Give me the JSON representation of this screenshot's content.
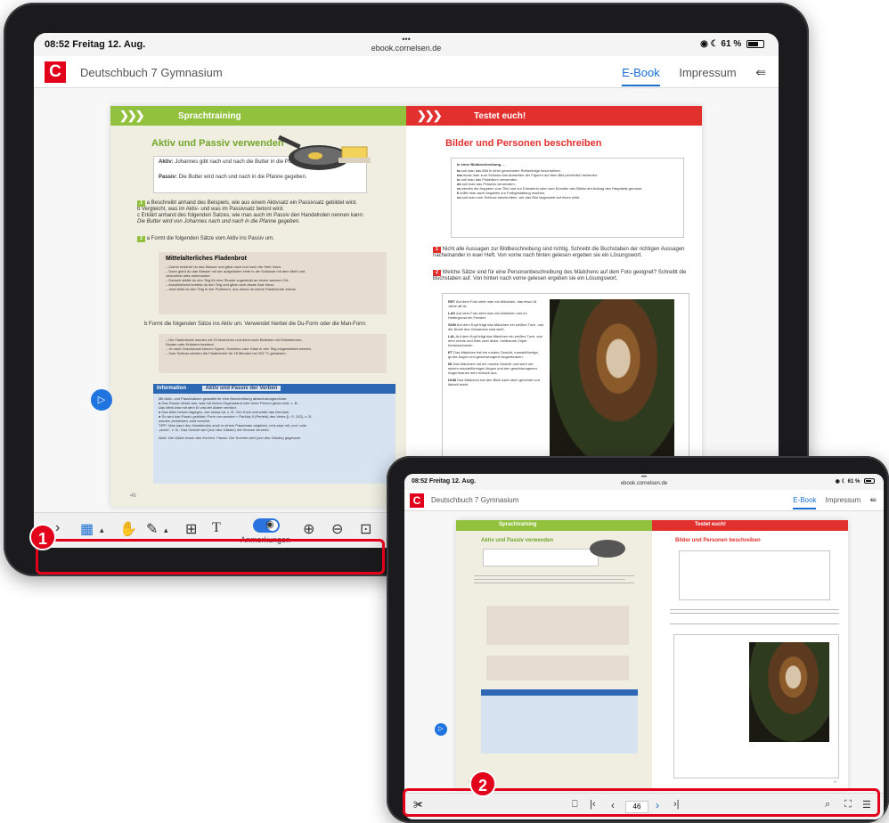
{
  "status": {
    "time_date": "08:52  Freitag 12. Aug.",
    "dots": "•••",
    "url": "ebook.cornelsen.de",
    "battery": "61 %"
  },
  "app": {
    "logo": "C",
    "title": "Deutschbuch 7 Gymnasium",
    "tab_ebook": "E-Book",
    "tab_impressum": "Impressum"
  },
  "left_page": {
    "banner": "Sprachtraining",
    "heading": "Aktiv und Passiv verwenden",
    "aktiv_label": "Aktiv:",
    "aktiv_sentence": "Johannes gibt nach und nach die Butter in die Pfanne.",
    "passiv_label": "Passiv:",
    "passiv_sentence": "Die Butter wird nach und nach in die Pfanne gegeben.",
    "task1": "a Beschreibt anhand des Beispiels, wie aus einem Aktivsatz ein Passivsatz gebildet wird.",
    "task1b": "b Vergleicht, was im Aktiv- und was im Passivsatz betont wird.",
    "task1c": "c Erklärt anhand des folgenden Satzes, wie man auch im Passiv den Handelnden nennen kann:",
    "task1c_example": "Die Butter wird von Johannes nach und nach in die Pfanne gegeben.",
    "task2": "a Formt die folgenden Sätze vom Aktiv ins Passiv um.",
    "recipe_title": "Mittelalterliches Fladenbrot",
    "recipe_lines": [
      "– Zuerst erwärmt du das Wasser und gibst nach und nach die Hefe hinzu.",
      "– Dann gießt du das Wasser mit der aufgelösten Hefe in die Schüssel mit dem Mehl und",
      "verknetest alles miteinander.",
      "– Danach stellst du den Teig für eine Stunde zugedeckt an einem warmen Ort.",
      "– Anschließend knetest du den Teig und gibst noch etwas Salz hinzu.",
      "– Jetzt teilst du den Teig in vier Portionen, aus denen du kleine Fladenbrote formst."
    ],
    "task2b": "b Formt die folgenden Sätze ins Aktiv um. Verwendet hierbei die Du-Form oder die Man-Form.",
    "recipe2_lines": [
      "– Die Fladenbrote werden mit Öl bestrichen und dann nach Belieben mit Kürbiskernen,",
      "Sesam oder Kräutern bestreut.",
      "– Je nach Geschmack können Speck, Schinken oder Käse in den Teig eingearbeitet werden.",
      "– Zum Schluss werden die Fladenbrote für 15 Minuten bei 225 °C gebacken."
    ],
    "info_label": "Information",
    "info_title": "Aktiv und Passiv der Verben",
    "info_lines": [
      "Mit Aktiv- und Passivsätzen gestaltet ihr eine Beschreibung abwechslungsreicher.",
      "● Das Passiv drückt aus, was mit einem Gegenstand oder einer Person getan wird, z. B.:",
      "Das Mehl wird mit dem Ei und der Butter verrührt.",
      "● Das Aktiv betont dagegen, wer etwas tut, z. B.: Der Koch schneidet das Gemüse.",
      "● So wird das Passiv gebildet: Form von werden + Partizip II (Perfekt) des Verbs (▷ S. 243), z. B.",
      "werden zerkleinert, wird verrührt.",
      "TIPP: Man kann den Handelnden auch in einem Passivsatz angeben, und zwar mit „von“ oder",
      "„durch“, z. B.: Das Gericht wird (von den Gästen) mit Genuss verzehrt.",
      "Aktiv: Die Gäste essen den Kuchen.        Passiv: Der Kuchen wird (von den Gästen) gegessen."
    ],
    "page_number": "46"
  },
  "right_page": {
    "banner": "Testet euch!",
    "heading": "Bilder und Personen beschreiben",
    "box_title": "In einer Bildbeschreibung ...",
    "box_lines": [
      [
        "ta",
        "soll man das Bild in einer geordneten Reihenfolge beschreiben."
      ],
      [
        "ma",
        "muss man zum Schluss das Aussehen der Figuren auf dem Bild persönlich bewerten."
      ],
      [
        "lo",
        "soll man das Präteritum verwenden."
      ],
      [
        "de",
        "soll man das Präsens verwenden."
      ],
      [
        "ra",
        "werden die Angaben zum Titel und zur Künstlerin oder zum Künstler des Bildes am Anfang des Hauptteils genannt."
      ],
      [
        "ll",
        "sollte man auch Angaben zur Farbgestaltung machen."
      ],
      [
        "os",
        "soll man zum Schluss beschreiben, wie das Bild insgesamt auf einen wirkt."
      ]
    ],
    "task1": "Nicht alle Aussagen zur Bildbeschreibung sind richtig. Schreibt die Buchstaben der richtigen Aussagen nacheinander in euer Heft. Von vorne nach hinten gelesen ergeben sie ein Lösungswort.",
    "task2": "Welche Sätze sind für eine Personenbeschreibung des Mädchens auf dem Foto geeignet? Schreibt die Buchstaben auf. Von hinten nach vorne gelesen ergeben sie ein Lösungswort.",
    "items": [
      [
        "RET",
        "Auf dem Foto sieht man ein Mädchen, das etwa 18 Jahre alt ist."
      ],
      [
        "LAK",
        "Auf dem Foto sieht man ein Mädchen und im Hintergrund ein Fenster."
      ],
      [
        "SUM",
        "Auf dem Kopf trägt das Mädchen ein weißes Tuch, und die Ärmel des Gewandes sind weiß."
      ],
      [
        "LAL",
        "Auf dem Kopf trägt das Mädchen ein weißes Tuch, aus dem rechts und links zwei dicke, hellbraune Zöpfe herausschauen."
      ],
      [
        "ET",
        "Das Mädchen hat ein rundes Gesicht, mandelförmige, große Augen und geschwungene Augenbrauen."
      ],
      [
        "MI",
        "Das Mädchen hat ein rundes Gesicht und sieht mit seinen mandelförmigen Augen und den geschwungenen Augenbrauen sehr hübsch aus."
      ],
      [
        "DUM",
        "Das Mädchen hat den Blick nach oben gerichtet und lächelt leicht."
      ]
    ],
    "page_number": "47"
  },
  "toolbar_a": {
    "annotations_label": "Anmerkungen"
  },
  "toolbar_b": {
    "page_value": "46"
  },
  "annotations": {
    "badge1": "1",
    "badge2": "2"
  },
  "colors": {
    "accent": "#1a6fd1",
    "brand_red": "#e2001a",
    "green": "#92c13e",
    "highlight": "#e2001a"
  }
}
